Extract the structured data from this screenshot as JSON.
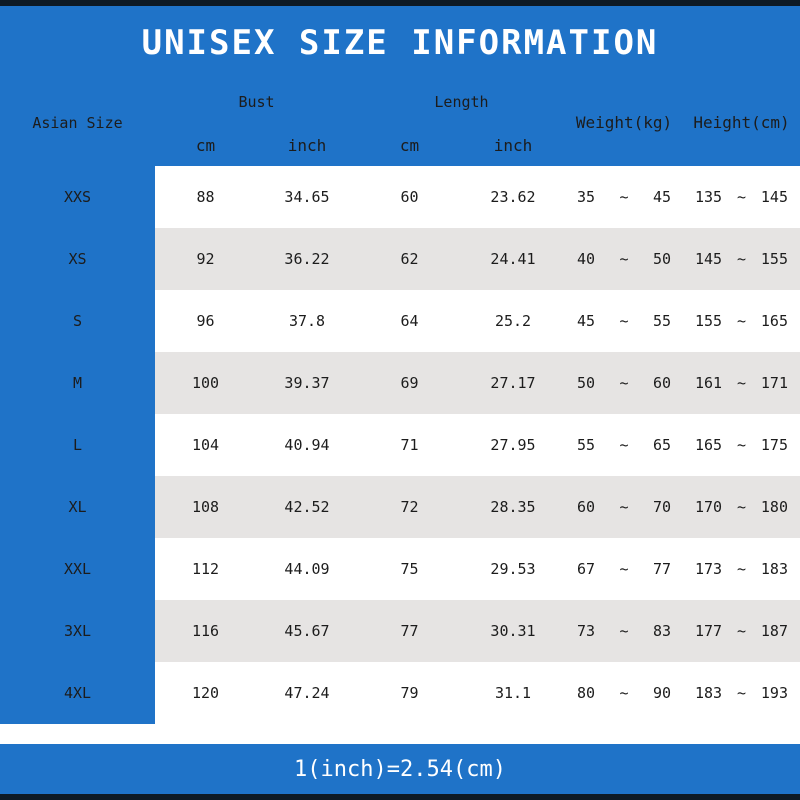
{
  "colors": {
    "brand_blue": "#1F73C8",
    "row_alt_gray": "#E6E4E3",
    "row_base_white": "#FFFFFF",
    "edge_dark": "#0E1A24",
    "text_dark": "#1C1C1C",
    "text_light": "#FFFFFF"
  },
  "title": "UNISEX SIZE INFORMATION",
  "footer": {
    "note": "1(inch)=2.54(cm)"
  },
  "header": {
    "size_label": "Asian Size",
    "groups": [
      {
        "label": "Bust",
        "units": [
          "cm",
          "inch"
        ]
      },
      {
        "label": "Length",
        "units": [
          "cm",
          "inch"
        ]
      }
    ],
    "weight_label": "Weight(kg)",
    "height_label": "Height(cm)",
    "range_separator": "~"
  },
  "chart_data": {
    "type": "table",
    "title": "UNISEX SIZE INFORMATION",
    "columns": [
      "Asian Size",
      "Bust cm",
      "Bust inch",
      "Length cm",
      "Length inch",
      "Weight(kg) min",
      "Weight(kg) max",
      "Height(cm) min",
      "Height(cm) max"
    ],
    "rows": [
      {
        "size": "XXS",
        "bust_cm": "88",
        "bust_inch": "34.65",
        "length_cm": "60",
        "length_inch": "23.62",
        "weight_min": "35",
        "weight_max": "45",
        "height_min": "135",
        "height_max": "145"
      },
      {
        "size": "XS",
        "bust_cm": "92",
        "bust_inch": "36.22",
        "length_cm": "62",
        "length_inch": "24.41",
        "weight_min": "40",
        "weight_max": "50",
        "height_min": "145",
        "height_max": "155"
      },
      {
        "size": "S",
        "bust_cm": "96",
        "bust_inch": "37.8",
        "length_cm": "64",
        "length_inch": "25.2",
        "weight_min": "45",
        "weight_max": "55",
        "height_min": "155",
        "height_max": "165"
      },
      {
        "size": "M",
        "bust_cm": "100",
        "bust_inch": "39.37",
        "length_cm": "69",
        "length_inch": "27.17",
        "weight_min": "50",
        "weight_max": "60",
        "height_min": "161",
        "height_max": "171"
      },
      {
        "size": "L",
        "bust_cm": "104",
        "bust_inch": "40.94",
        "length_cm": "71",
        "length_inch": "27.95",
        "weight_min": "55",
        "weight_max": "65",
        "height_min": "165",
        "height_max": "175"
      },
      {
        "size": "XL",
        "bust_cm": "108",
        "bust_inch": "42.52",
        "length_cm": "72",
        "length_inch": "28.35",
        "weight_min": "60",
        "weight_max": "70",
        "height_min": "170",
        "height_max": "180"
      },
      {
        "size": "XXL",
        "bust_cm": "112",
        "bust_inch": "44.09",
        "length_cm": "75",
        "length_inch": "29.53",
        "weight_min": "67",
        "weight_max": "77",
        "height_min": "173",
        "height_max": "183"
      },
      {
        "size": "3XL",
        "bust_cm": "116",
        "bust_inch": "45.67",
        "length_cm": "77",
        "length_inch": "30.31",
        "weight_min": "73",
        "weight_max": "83",
        "height_min": "177",
        "height_max": "187"
      },
      {
        "size": "4XL",
        "bust_cm": "120",
        "bust_inch": "47.24",
        "length_cm": "79",
        "length_inch": "31.1",
        "weight_min": "80",
        "weight_max": "90",
        "height_min": "183",
        "height_max": "193"
      }
    ]
  }
}
